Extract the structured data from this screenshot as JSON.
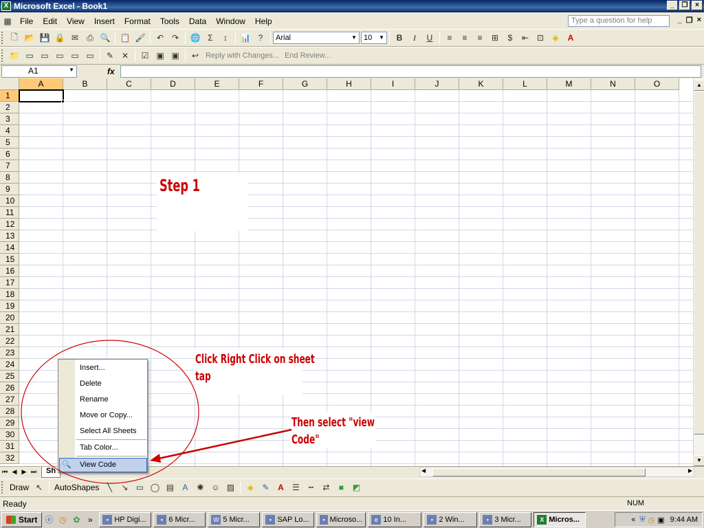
{
  "window": {
    "title": "Microsoft Excel - Book1",
    "app_icon": "excel-icon"
  },
  "menubar": {
    "items": [
      "File",
      "Edit",
      "View",
      "Insert",
      "Format",
      "Tools",
      "Data",
      "Window",
      "Help"
    ],
    "help_placeholder": "Type a question for help"
  },
  "format_toolbar": {
    "font": "Arial",
    "size": "10",
    "bold": "B",
    "italic": "I",
    "underline": "U",
    "currency": "$"
  },
  "review_toolbar": {
    "reply": "Reply with Changes...",
    "end_review": "End Review..."
  },
  "formulabar": {
    "name_box": "A1",
    "fx": "fx",
    "formula": ""
  },
  "grid": {
    "columns": [
      "A",
      "B",
      "C",
      "D",
      "E",
      "F",
      "G",
      "H",
      "I",
      "J",
      "K",
      "L",
      "M",
      "N",
      "O"
    ],
    "rows": [
      "1",
      "2",
      "3",
      "4",
      "5",
      "6",
      "7",
      "8",
      "9",
      "10",
      "11",
      "12",
      "13",
      "14",
      "15",
      "16",
      "17",
      "18",
      "19",
      "20",
      "21",
      "22",
      "23",
      "24",
      "25",
      "26",
      "27",
      "28",
      "29",
      "30",
      "31",
      "32"
    ],
    "active_cell": "A1"
  },
  "sheet_tab": {
    "label": "Sh"
  },
  "context_menu": {
    "items": [
      "Insert...",
      "Delete",
      "Rename",
      "Move or Copy...",
      "Select All Sheets",
      "Tab Color...",
      "View Code"
    ],
    "highlighted": "View Code"
  },
  "annotations": {
    "step": "Step 1",
    "instruction1_line1": "Click Right Click on sheet",
    "instruction1_line2": "tap",
    "instruction2_line1": "Then select \"view",
    "instruction2_line2": "Code\"",
    "color": "#cc0000"
  },
  "drawbar": {
    "draw": "Draw",
    "autoshapes": "AutoShapes"
  },
  "statusbar": {
    "status": "Ready",
    "num": "NUM"
  },
  "taskbar": {
    "start": "Start",
    "buttons": [
      "HP Digi...",
      "6 Micr...",
      "5 Micr...",
      "SAP Lo...",
      "Microso...",
      "10 In...",
      "2 Win...",
      "3 Micr...",
      "Micros..."
    ],
    "clock": "9:44 AM"
  }
}
